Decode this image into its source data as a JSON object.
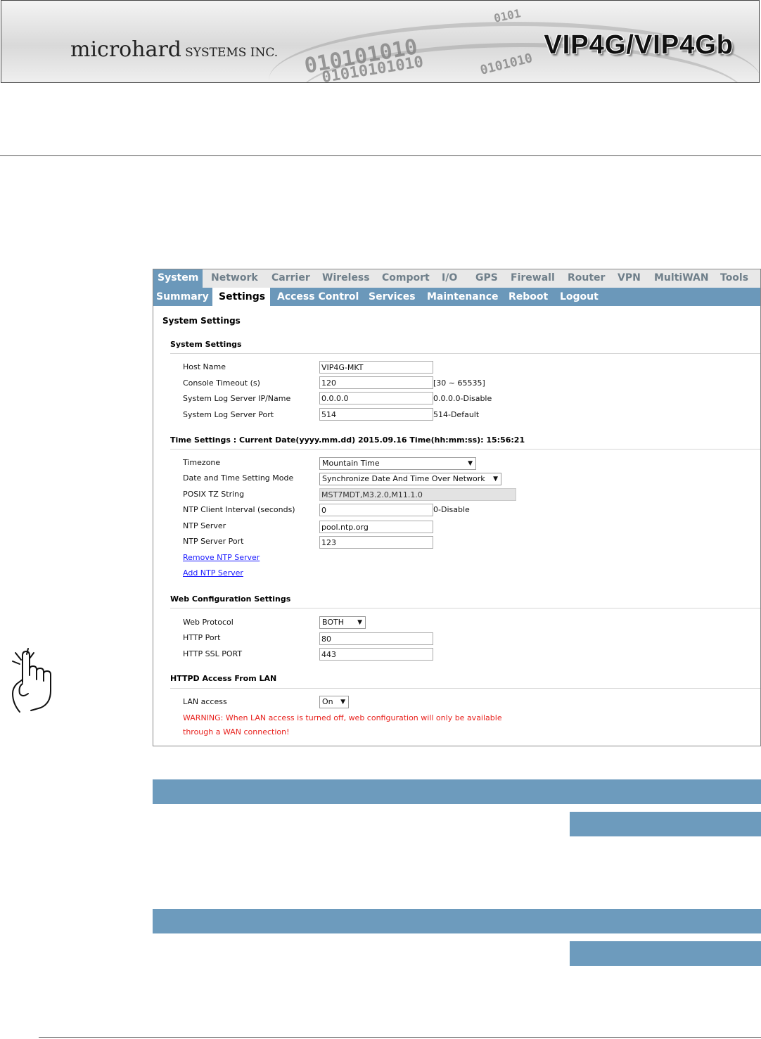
{
  "header": {
    "company_main": "microhard",
    "company_suffix": "SYSTEMS INC.",
    "product": "VIP4G/VIP4Gb",
    "binary_rows": [
      "0101",
      "010101010",
      "01010101010",
      "0101010"
    ]
  },
  "top_nav": {
    "items": [
      "System",
      "Network",
      "Carrier",
      "Wireless",
      "Comport",
      "I/O",
      "GPS",
      "Firewall",
      "Router",
      "VPN",
      "MultiWAN",
      "Tools"
    ],
    "active": "System"
  },
  "sub_nav": {
    "items": [
      "Summary",
      "Settings",
      "Access Control",
      "Services",
      "Maintenance",
      "Reboot",
      "Logout"
    ],
    "active": "Settings"
  },
  "page_title": "System Settings",
  "system_settings": {
    "heading": "System Settings",
    "host_name": {
      "label": "Host Name",
      "value": "VIP4G-MKT"
    },
    "console_timeout": {
      "label": "Console Timeout (s)",
      "value": "120",
      "hint": "[30 ~ 65535]"
    },
    "log_server_ip": {
      "label": "System Log Server IP/Name",
      "value": "0.0.0.0",
      "hint": "0.0.0.0-Disable"
    },
    "log_server_port": {
      "label": "System Log Server Port",
      "value": "514",
      "hint": "514-Default"
    }
  },
  "time_settings": {
    "heading": "Time Settings : Current Date(yyyy.mm.dd) 2015.09.16 Time(hh:mm:ss): 15:56:21",
    "timezone": {
      "label": "Timezone",
      "value": "Mountain Time"
    },
    "mode": {
      "label": "Date and Time Setting Mode",
      "value": "Synchronize Date And Time Over Network"
    },
    "posix": {
      "label": "POSIX TZ String",
      "value": "MST7MDT,M3.2.0,M11.1.0"
    },
    "ntp_interval": {
      "label": "NTP Client Interval (seconds)",
      "value": "0",
      "hint": "0-Disable"
    },
    "ntp_server": {
      "label": "NTP Server",
      "value": "pool.ntp.org"
    },
    "ntp_port": {
      "label": "NTP Server Port",
      "value": "123"
    },
    "remove_link": "Remove NTP Server",
    "add_link": "Add NTP Server"
  },
  "web_config": {
    "heading": "Web Configuration Settings",
    "protocol": {
      "label": "Web Protocol",
      "value": "BOTH"
    },
    "http_port": {
      "label": "HTTP Port",
      "value": "80"
    },
    "ssl_port": {
      "label": "HTTP SSL PORT",
      "value": "443"
    }
  },
  "httpd": {
    "heading": "HTTPD Access From LAN",
    "lan_access": {
      "label": "LAN access",
      "value": "On"
    },
    "warning_line1": "WARNING: When LAN access is turned off, web configuration will only be available",
    "warning_line2": "through a WAN connection!"
  },
  "colors": {
    "nav_blue": "#6b98ba",
    "warning_red": "#e8221e",
    "link_blue": "#1a1aff"
  }
}
